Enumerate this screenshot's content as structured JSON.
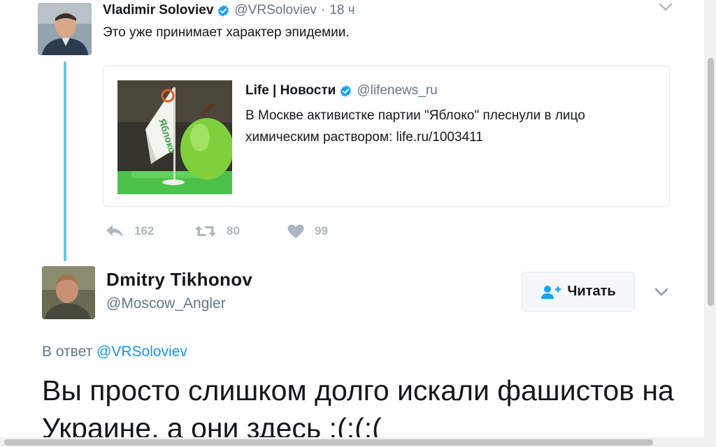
{
  "tweet": {
    "author_name": "Vladimir Soloviev",
    "author_handle": "@VRSoloviev",
    "separator": "·",
    "time": "18 ч",
    "text": "Это уже принимает характер эпидемии.",
    "quote": {
      "author_name": "Life | Новости",
      "author_handle": "@lifenews_ru",
      "text": "В Москве активистке партии \"Яблоко\" плеснули в лицо химическим раствором: life.ru/1003411",
      "image_flag_text": "Яблоко"
    },
    "actions": {
      "reply_count": "162",
      "retweet_count": "80",
      "like_count": "99"
    }
  },
  "reply": {
    "author_name": "Dmitry Tikhonov",
    "author_handle": "@Moscow_Angler",
    "follow_label": "Читать",
    "in_reply_prefix": "В ответ",
    "in_reply_handle": "@VRSoloviev",
    "text": "Вы просто слишком долго искали фашистов на Украине, а они здесь :(:(:("
  },
  "colors": {
    "link": "#1b95e0",
    "verified": "#1da1f2",
    "thread_line": "#6ac3e6",
    "muted": "#657786",
    "action_icon": "#aab8c2"
  }
}
